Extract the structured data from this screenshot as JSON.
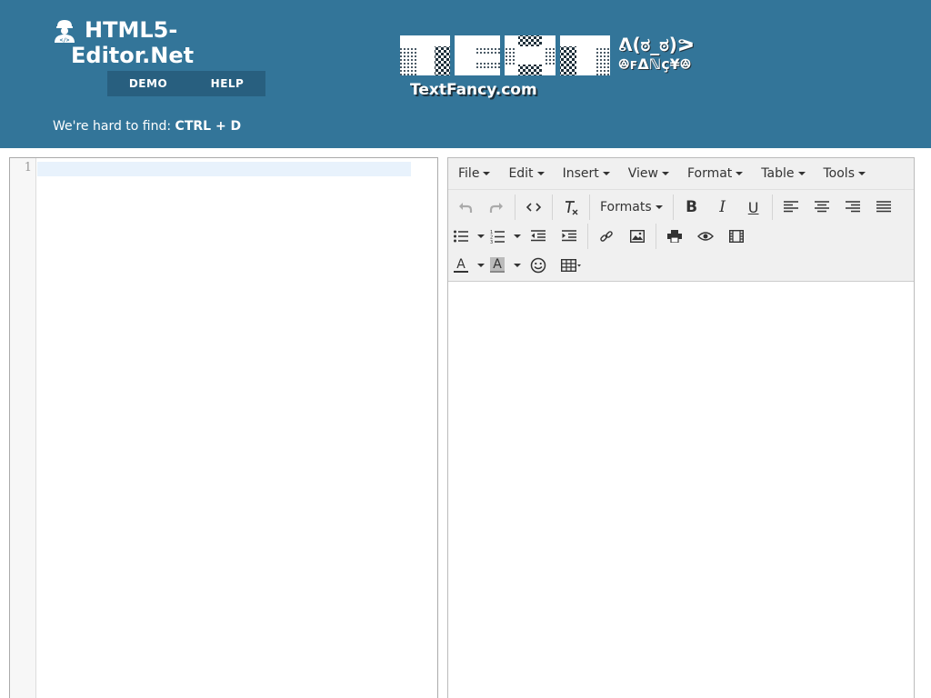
{
  "header": {
    "logo_line1": "HTML5-",
    "logo_line2": "Editor.Net",
    "nav": {
      "demo": "DEMO",
      "help": "HELP"
    },
    "tagline_prefix": "We're hard to find: ",
    "tagline_shortcut": "CTRL + D",
    "banner": {
      "logo_word": "TEXT",
      "emoticon": "ᕕ(ಠ_ಠ)ᕗ",
      "emoticon_line2": "ꔮꜰΔℕç¥ꔮ",
      "site": "TextFancy.com"
    }
  },
  "code_editor": {
    "line_numbers": [
      "1"
    ],
    "content": ""
  },
  "wysiwyg": {
    "menubar": [
      "File",
      "Edit",
      "Insert",
      "View",
      "Format",
      "Table",
      "Tools"
    ],
    "toolbar": {
      "formats_label": "Formats",
      "buttons": [
        "undo",
        "redo",
        "source-code",
        "clear-formatting",
        "formats",
        "bold",
        "italic",
        "underline",
        "align-left",
        "align-center",
        "align-right",
        "justify",
        "bullet-list",
        "numbered-list",
        "outdent",
        "indent",
        "link",
        "image",
        "print",
        "preview",
        "media",
        "text-color",
        "background-color",
        "emoticons",
        "table"
      ],
      "bold": "B",
      "italic": "I",
      "underline": "U",
      "text_color": "A",
      "bg_color": "A"
    },
    "colors": {
      "text_color_bar": "#333333",
      "bg_color_bar": "#888888",
      "bg_color_fill": "#bbbbbb"
    },
    "content": ""
  },
  "colors": {
    "header_bg": "#337599",
    "nav_bg": "#285f7f",
    "toolbar_bg": "#f0f0f0",
    "active_line": "#e8f2fc"
  }
}
